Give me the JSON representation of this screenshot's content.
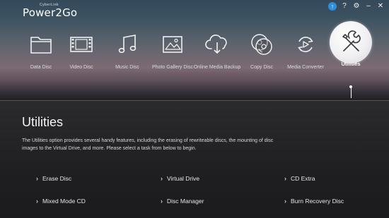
{
  "app": {
    "brand_small": "CyberLink",
    "brand_name": "Power2Go"
  },
  "window_controls": {
    "update": "↑",
    "help": "?",
    "settings": "⚙",
    "minimize": "–",
    "close": "✕"
  },
  "nav": {
    "items": [
      {
        "label": "Data Disc",
        "icon": "folder-icon"
      },
      {
        "label": "Video Disc",
        "icon": "film-icon"
      },
      {
        "label": "Music Disc",
        "icon": "music-note-icon"
      },
      {
        "label": "Photo Gallery Disc",
        "icon": "photo-icon"
      },
      {
        "label": "Online Media Backup",
        "icon": "cloud-download-icon"
      },
      {
        "label": "Copy Disc",
        "icon": "copy-disc-icon"
      },
      {
        "label": "Media Converter",
        "icon": "convert-icon"
      },
      {
        "label": "Utilities",
        "icon": "tools-icon",
        "active": true
      }
    ]
  },
  "content": {
    "title": "Utilities",
    "description": "The Utilities option provides several handy features, including the erasing of rewriteable discs, the mounting of disc images to the Virtual Drive, and more. Please select a task from below to begin.",
    "tasks": [
      {
        "label": "Erase Disc"
      },
      {
        "label": "Virtual Drive"
      },
      {
        "label": "CD Extra"
      },
      {
        "label": "Mixed Mode CD"
      },
      {
        "label": "Disc Manager"
      },
      {
        "label": "Burn Recovery Disc"
      }
    ]
  },
  "colors": {
    "accent_blue": "#2f8fdb",
    "panel_bg": "#1f1f21",
    "text_light": "#e8e8e8"
  }
}
